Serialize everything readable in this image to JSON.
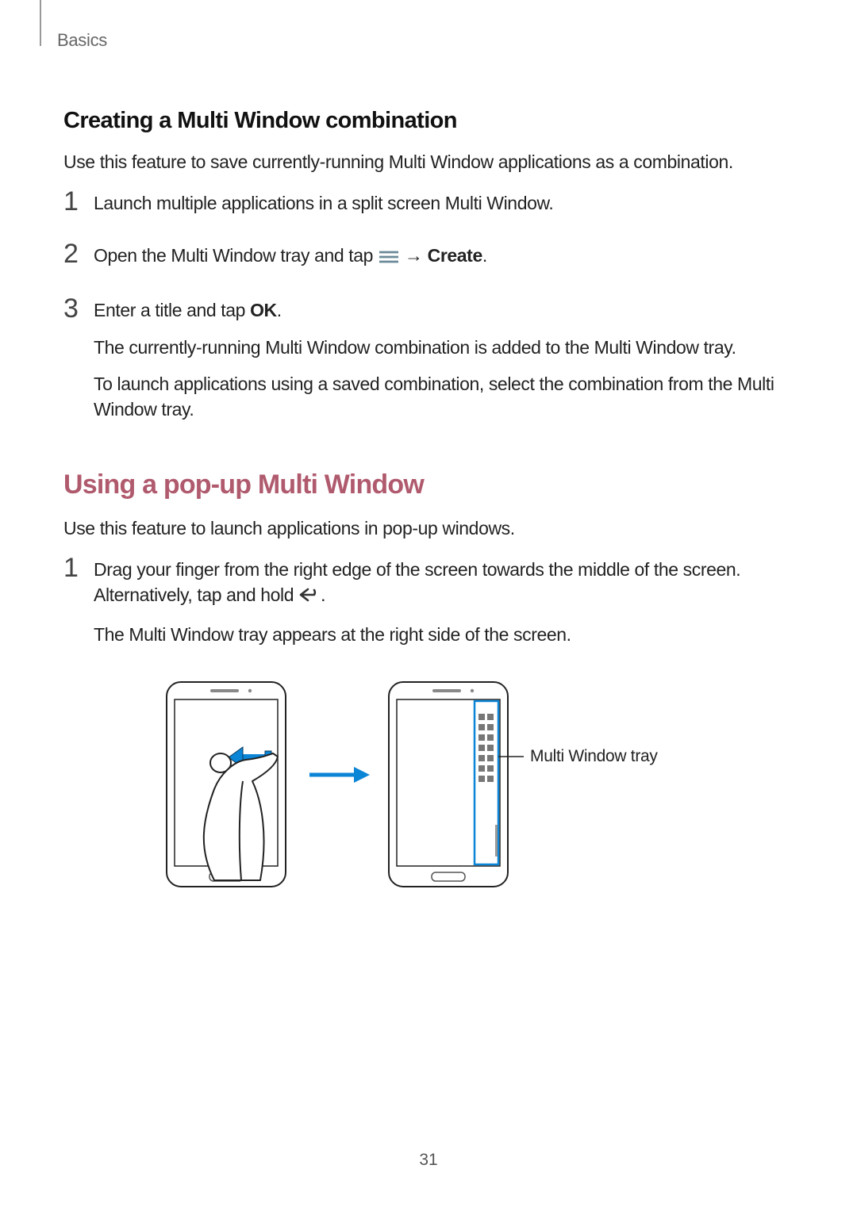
{
  "header": {
    "section": "Basics"
  },
  "section1": {
    "title": "Creating a Multi Window combination",
    "intro": "Use this feature to save currently-running Multi Window applications as a combination.",
    "step1": {
      "num": "1",
      "text": "Launch multiple applications in a split screen Multi Window."
    },
    "step2": {
      "num": "2",
      "pre": "Open the Multi Window tray and tap ",
      "arrow": "→",
      "create": "Create",
      "post": "."
    },
    "step3": {
      "num": "3",
      "line1a": "Enter a title and tap ",
      "line1b": "OK",
      "line1c": ".",
      "para2": "The currently-running Multi Window combination is added to the Multi Window tray.",
      "para3": "To launch applications using a saved combination, select the combination from the Multi Window tray."
    }
  },
  "section2": {
    "title": "Using a pop-up Multi Window",
    "intro": "Use this feature to launch applications in pop-up windows.",
    "step1": {
      "num": "1",
      "line1a": "Drag your finger from the right edge of the screen towards the middle of the screen. Alternatively, tap and hold ",
      "line1b": ".",
      "para2": "The Multi Window tray appears at the right side of the screen."
    }
  },
  "illustration": {
    "callout": "Multi Window tray"
  },
  "page_number": "31"
}
